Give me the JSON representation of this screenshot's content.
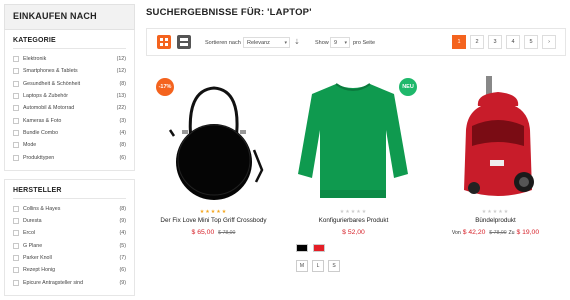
{
  "sidebar": {
    "header": "EINKAUFEN NACH",
    "categories": {
      "title": "KATEGORIE",
      "items": [
        {
          "label": "Elektronik",
          "count": "(12)"
        },
        {
          "label": "Smartphones & Tablets",
          "count": "(12)"
        },
        {
          "label": "Gesundheit & Schönheit",
          "count": "(8)"
        },
        {
          "label": "Laptops & Zubehör",
          "count": "(13)"
        },
        {
          "label": "Automobil & Motorrad",
          "count": "(22)"
        },
        {
          "label": "Kameras & Foto",
          "count": "(3)"
        },
        {
          "label": "Bundle Combo",
          "count": "(4)"
        },
        {
          "label": "Mode",
          "count": "(8)"
        },
        {
          "label": "Produkttypen",
          "count": "(6)"
        }
      ]
    },
    "manufacturers": {
      "title": "HERSTELLER",
      "items": [
        {
          "label": "Collins & Hayes",
          "count": "(8)"
        },
        {
          "label": "Duresta",
          "count": "(9)"
        },
        {
          "label": "Ercol",
          "count": "(4)"
        },
        {
          "label": "G Plane",
          "count": "(5)"
        },
        {
          "label": "Parker Knoll",
          "count": "(7)"
        },
        {
          "label": "Rezept Honig",
          "count": "(6)"
        },
        {
          "label": "Epicure Antragsteller sind",
          "count": "(9)"
        }
      ]
    }
  },
  "main": {
    "title": "SUCHERGEBNISSE FÜR: 'LAPTOP'",
    "toolbar": {
      "sort_label": "Sortieren nach",
      "sort_value": "Relevanz",
      "show_label": "Show",
      "show_value": "9",
      "per_page_label": "pro Seite",
      "pages": [
        "1",
        "2",
        "3",
        "4",
        "5"
      ],
      "next_icon": "chevron-right-icon"
    },
    "products": [
      {
        "badge": "-17%",
        "name": "Der Fix Love Mini Top Griff Crossbody",
        "price": "$ 65,00",
        "old_price": "$ 78,00",
        "rating": 5,
        "rating_color": "#f4a51c"
      },
      {
        "badge": "NEU",
        "name": "Konfigurierbares Produkt",
        "price": "$ 52,00",
        "rating": 0,
        "colors": [
          "#000000",
          "#e41e26"
        ],
        "sizes": [
          "M",
          "L",
          "S"
        ]
      },
      {
        "name": "Bündelprodukt",
        "price_prefix": "Von",
        "price": "$ 42,20",
        "old_price": "$ 78,00",
        "price_mid": "Zu",
        "price_to": "$ 19,00",
        "rating": 0
      }
    ]
  },
  "colors": {
    "accent": "#f4631e",
    "sale": "#d7222a",
    "new_badge": "#1fb86b"
  }
}
